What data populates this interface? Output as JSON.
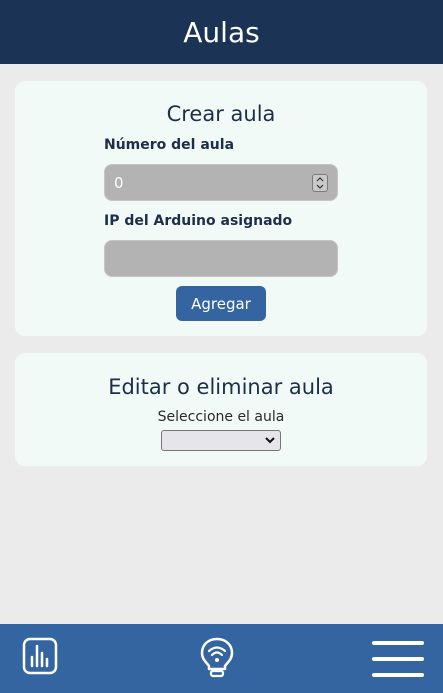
{
  "header": {
    "title": "Aulas"
  },
  "create_card": {
    "title": "Crear aula",
    "number_label": "Número del aula",
    "number_value": "0",
    "ip_label": "IP del Arduino asignado",
    "ip_value": "",
    "add_button": "Agregar"
  },
  "edit_card": {
    "title": "Editar o eliminar aula",
    "select_label": "Seleccione el aula",
    "select_value": ""
  },
  "footer": {
    "icons": [
      "chart-icon",
      "lightbulb-wifi-icon",
      "menu-icon"
    ]
  },
  "colors": {
    "header_bg": "#1b3456",
    "footer_bg": "#3565a0",
    "button_bg": "#3565a0",
    "card_bg": "#f2faf7",
    "page_bg": "#ebebeb"
  }
}
